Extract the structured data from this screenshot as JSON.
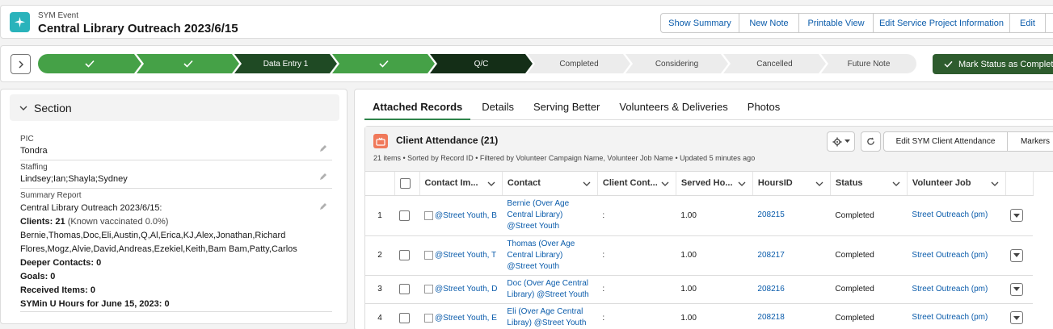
{
  "header": {
    "object_label": "SYM Event",
    "title": "Central Library Outreach 2023/6/15",
    "actions": [
      "Show Summary",
      "New Note",
      "Printable View",
      "Edit Service Project Information",
      "Edit"
    ]
  },
  "path": {
    "stages": [
      {
        "label": "",
        "state": "complete"
      },
      {
        "label": "",
        "state": "complete"
      },
      {
        "label": "Data Entry 1",
        "state": "complete-dark"
      },
      {
        "label": "",
        "state": "complete"
      },
      {
        "label": "Q/C",
        "state": "current"
      },
      {
        "label": "Completed",
        "state": "incomplete"
      },
      {
        "label": "Considering",
        "state": "incomplete"
      },
      {
        "label": "Cancelled",
        "state": "incomplete"
      },
      {
        "label": "Future Note",
        "state": "incomplete"
      }
    ],
    "mark_button": "Mark Status as Complete"
  },
  "section": {
    "title": "Section",
    "pic_label": "PIC",
    "pic_value": "Tondra",
    "staffing_label": "Staffing",
    "staffing_value": "Lindsey;Ian;Shayla;Sydney",
    "summary_label": "Summary Report",
    "summary": {
      "line1": "Central Library Outreach 2023/6/15:",
      "clients_label": "Clients: 21",
      "clients_note": " (Known vaccinated 0.0%)",
      "names": "Bernie,Thomas,Doc,Eli,Austin,Q,Al,Erica,KJ,Alex,Jonathan,Richard Flores,Mogz,Alvie,David,Andreas,Ezekiel,Keith,Bam Bam,Patty,Carlos",
      "deeper": "Deeper Contacts: 0",
      "goals": "Goals: 0",
      "received": "Received Items: 0",
      "symin": "SYMin U Hours for June 15, 2023: 0"
    }
  },
  "tabs": [
    "Attached Records",
    "Details",
    "Serving Better",
    "Volunteers & Deliveries",
    "Photos"
  ],
  "related": {
    "title": "Client Attendance (21)",
    "meta": "21 items • Sorted by Record ID • Filtered by Volunteer Campaign Name, Volunteer Job Name • Updated 5 minutes ago",
    "edit_button": "Edit SYM Client Attendance",
    "markers_button": "Markers",
    "columns": [
      "Contact Im...",
      "Contact",
      "Client Cont...",
      "Served Ho...",
      "HoursID",
      "Status",
      "Volunteer Job"
    ],
    "rows": [
      {
        "num": "1",
        "image": "@Street Youth, B",
        "contact": "Bernie (Over Age Central Library) @Street Youth",
        "client_contact": ":",
        "served": "1.00",
        "hours_id": "208215",
        "status": "Completed",
        "job": "Street Outreach (pm)"
      },
      {
        "num": "2",
        "image": "@Street Youth, T",
        "contact": "Thomas (Over Age Central Library) @Street Youth",
        "client_contact": ":",
        "served": "1.00",
        "hours_id": "208217",
        "status": "Completed",
        "job": "Street Outreach (pm)"
      },
      {
        "num": "3",
        "image": "@Street Youth, D",
        "contact": "Doc (Over Age Central Library) @Street Youth",
        "client_contact": ":",
        "served": "1.00",
        "hours_id": "208216",
        "status": "Completed",
        "job": "Street Outreach (pm)"
      },
      {
        "num": "4",
        "image": "@Street Youth, E",
        "contact": "Eli (Over Age Central Libray) @Street Youth",
        "client_contact": ":",
        "served": "1.00",
        "hours_id": "208218",
        "status": "Completed",
        "job": "Street Outreach (pm)"
      }
    ]
  },
  "colors": {
    "complete": "#45a147",
    "current": "#142e17",
    "mark_button": "#2e5c2e",
    "link": "#0b5cab",
    "app_icon": "#2ab3bb",
    "related_icon": "#f0795a"
  }
}
